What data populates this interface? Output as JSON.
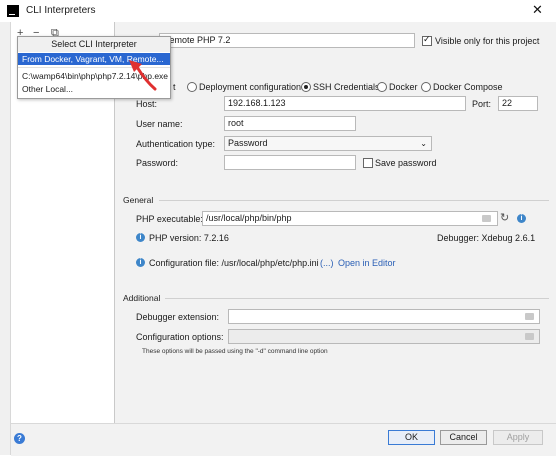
{
  "window": {
    "title": "CLI Interpreters"
  },
  "left_panel": {
    "add_label": "+",
    "remove_label": "−",
    "copy_label": "⧉"
  },
  "popup": {
    "header": "Select CLI Interpreter",
    "items": [
      {
        "label": "From Docker, Vagrant, VM, Remote...",
        "selected": true
      },
      {
        "label": "C:\\wamp64\\bin\\php\\php7.2.14\\php.exe",
        "selected": false
      },
      {
        "label": "Other Local...",
        "selected": false
      }
    ]
  },
  "main": {
    "name_value": "Remote PHP 7.2",
    "visible_only_label": "Visible only for this project",
    "connection_options": [
      "Vagrant",
      "Deployment configuration",
      "SSH Credentials",
      "Docker",
      "Docker Compose"
    ],
    "selected_connection": "SSH Credentials",
    "host_label": "Host:",
    "host_value": "192.168.1.123",
    "port_label": "Port:",
    "port_value": "22",
    "username_label": "User name:",
    "username_value": "root",
    "auth_label": "Authentication type:",
    "auth_value": "Password",
    "password_label": "Password:",
    "password_value": "",
    "save_password_label": "Save password"
  },
  "general": {
    "section_label": "General",
    "php_exec_label": "PHP executable:",
    "php_exec_value": "/usr/local/php/bin/php",
    "php_version": "PHP version: 7.2.16",
    "debugger": "Debugger: Xdebug 2.6.1",
    "config_file": "Configuration file: /usr/local/php/etc/php.ini",
    "config_more": "(...)",
    "open_in_editor": "Open in Editor"
  },
  "additional": {
    "section_label": "Additional",
    "debugger_ext_label": "Debugger extension:",
    "debugger_ext_value": "",
    "config_options_label": "Configuration options:",
    "config_options_value": "",
    "note": "These options will be passed using the \"-d\" command line option"
  },
  "footer": {
    "ok_label": "OK",
    "cancel_label": "Cancel",
    "apply_label": "Apply",
    "help_label": "?"
  },
  "icons": {
    "close": "close-icon",
    "refresh": "refresh-icon",
    "info": "info-icon",
    "folder": "folder-icon"
  },
  "colors": {
    "accent": "#2a67d1",
    "link": "#2a5fb5",
    "info": "#3e86c9",
    "arrow": "#e03030"
  }
}
